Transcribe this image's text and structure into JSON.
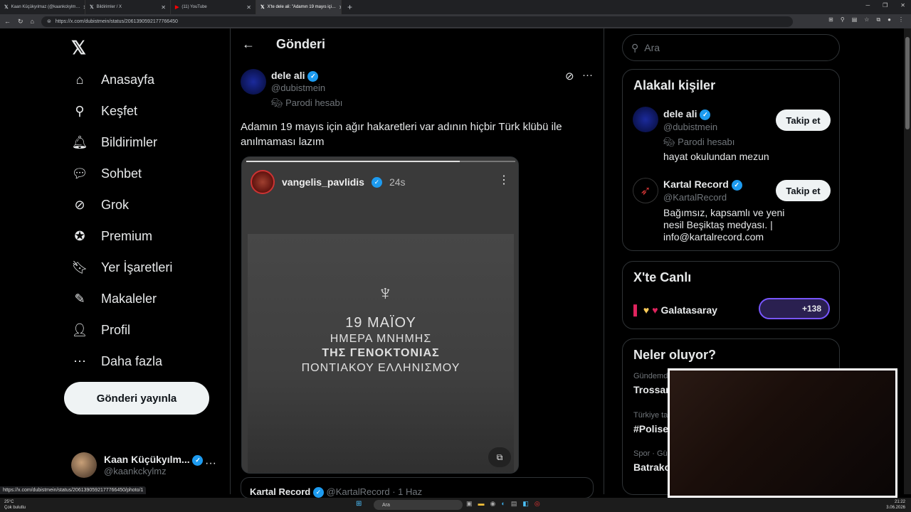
{
  "browser": {
    "tabs": [
      {
        "label": "Kaan Küçükyılmaz (@kaankckylm…",
        "icon": "x-icon"
      },
      {
        "label": "Bildirimler / X",
        "icon": "x-icon"
      },
      {
        "label": "(11) YouTube",
        "icon": "youtube-icon"
      },
      {
        "label": "X'te dele ali: \"Adamın 19 mayıs içi…",
        "icon": "x-icon"
      }
    ],
    "url": "https://x.com/dubistmein/status/2061390592177766450"
  },
  "nav": {
    "logo": "𝕏",
    "items": [
      {
        "label": "Anasayfa",
        "icon": "⌂"
      },
      {
        "label": "Keşfet",
        "icon": "⚲"
      },
      {
        "label": "Bildirimler",
        "icon": "🔔︎"
      },
      {
        "label": "Sohbet",
        "icon": "💬︎"
      },
      {
        "label": "Grok",
        "icon": "⊘"
      },
      {
        "label": "Premium",
        "icon": "✪"
      },
      {
        "label": "Yer İşaretleri",
        "icon": "🔖︎"
      },
      {
        "label": "Makaleler",
        "icon": "✎"
      },
      {
        "label": "Profil",
        "icon": "👤︎"
      },
      {
        "label": "Daha fazla",
        "icon": "⋯"
      }
    ],
    "post_button": "Gönderi yayınla",
    "account": {
      "name": "Kaan Küçükyılm...",
      "handle": "@kaankckylmz",
      "more": "···"
    }
  },
  "main": {
    "back": "←",
    "title": "Gönderi",
    "post": {
      "name": "dele ali",
      "handle": "@dubistmein",
      "parody": "Parodi hesabı",
      "text": "Adamın 19 mayıs için ağır hakaretleri var adının hiçbir Türk klübü ile anılmaması lazım",
      "more": "···",
      "story": {
        "user": "vangelis_pavlidis",
        "time": "24s",
        "line1": "19 ΜΑΪΟΥ",
        "line2": "ΗΜΕΡΑ ΜΝΗΜΗΣ",
        "line3": "ΤΗΣ ΓΕΝΟΚΤΟΝΙΑΣ",
        "line4": "ΠΟΝΤΙΑΚΟΥ ΕΛΛΗΝΙΣΜΟΥ"
      },
      "quote": {
        "name": "Kartal Record",
        "handle": "@KartalRecord",
        "date": "· 1 Haz"
      }
    }
  },
  "sidebar": {
    "search_placeholder": "Ara",
    "related_title": "Alakalı kişiler",
    "related": [
      {
        "name": "dele ali",
        "handle": "@dubistmein",
        "parody": "Parodi hesabı",
        "bio": "hayat okulundan mezun",
        "follow": "Takip et"
      },
      {
        "name": "Kartal Record",
        "handle": "@KartalRecord",
        "bio": "Bağımsız, kapsamlı ve yeni nesil Beşiktaş medyası. | info@kartalrecord.com",
        "follow": "Takip et"
      }
    ],
    "live_title": "X'te Canlı",
    "live": {
      "name": "Galatasaray",
      "count": "+138"
    },
    "trends_title": "Neler oluyor?",
    "trends": [
      {
        "category": "Gündemde",
        "name": "Trossard"
      },
      {
        "category": "Türkiye ta…",
        "name": "#Polise"
      },
      {
        "category": "Spor · Gü…",
        "name": "Batrako"
      }
    ]
  },
  "status_url": "https://x.com/dubistmein/status/2061390592177766450/photo/1",
  "taskbar": {
    "temp": "25°C",
    "weather": "Çok bulutlu",
    "search": "Ara",
    "time": "21:22",
    "date": "3.06.2026"
  }
}
